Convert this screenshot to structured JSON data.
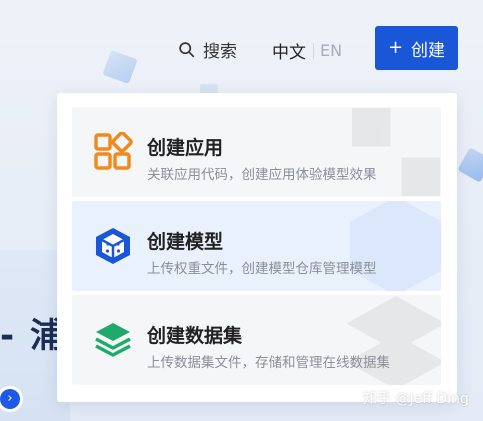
{
  "nav": {
    "search_label": "搜索",
    "lang_zh": "中文",
    "lang_en": "EN",
    "create_plus": "+",
    "create_label": "创建"
  },
  "background": {
    "heading": "- 浦"
  },
  "dropdown": {
    "items": [
      {
        "title": "创建应用",
        "description": "关联应用代码，创建应用体验模型效果",
        "icon": "apps-grid-icon",
        "color": "#f08a1c"
      },
      {
        "title": "创建模型",
        "description": "上传权重文件，创建模型仓库管理模型",
        "icon": "cube-icon",
        "color": "#1a56d8"
      },
      {
        "title": "创建数据集",
        "description": "上传数据集文件，存储和管理在线数据集",
        "icon": "layers-icon",
        "color": "#1faa6b"
      }
    ]
  },
  "watermark": "知乎 @Jeff Ding",
  "colors": {
    "primary": "#1a56d8",
    "app_orange": "#f08a1c",
    "dataset_green": "#1faa6b",
    "highlight_bg": "#e9f1fd"
  }
}
